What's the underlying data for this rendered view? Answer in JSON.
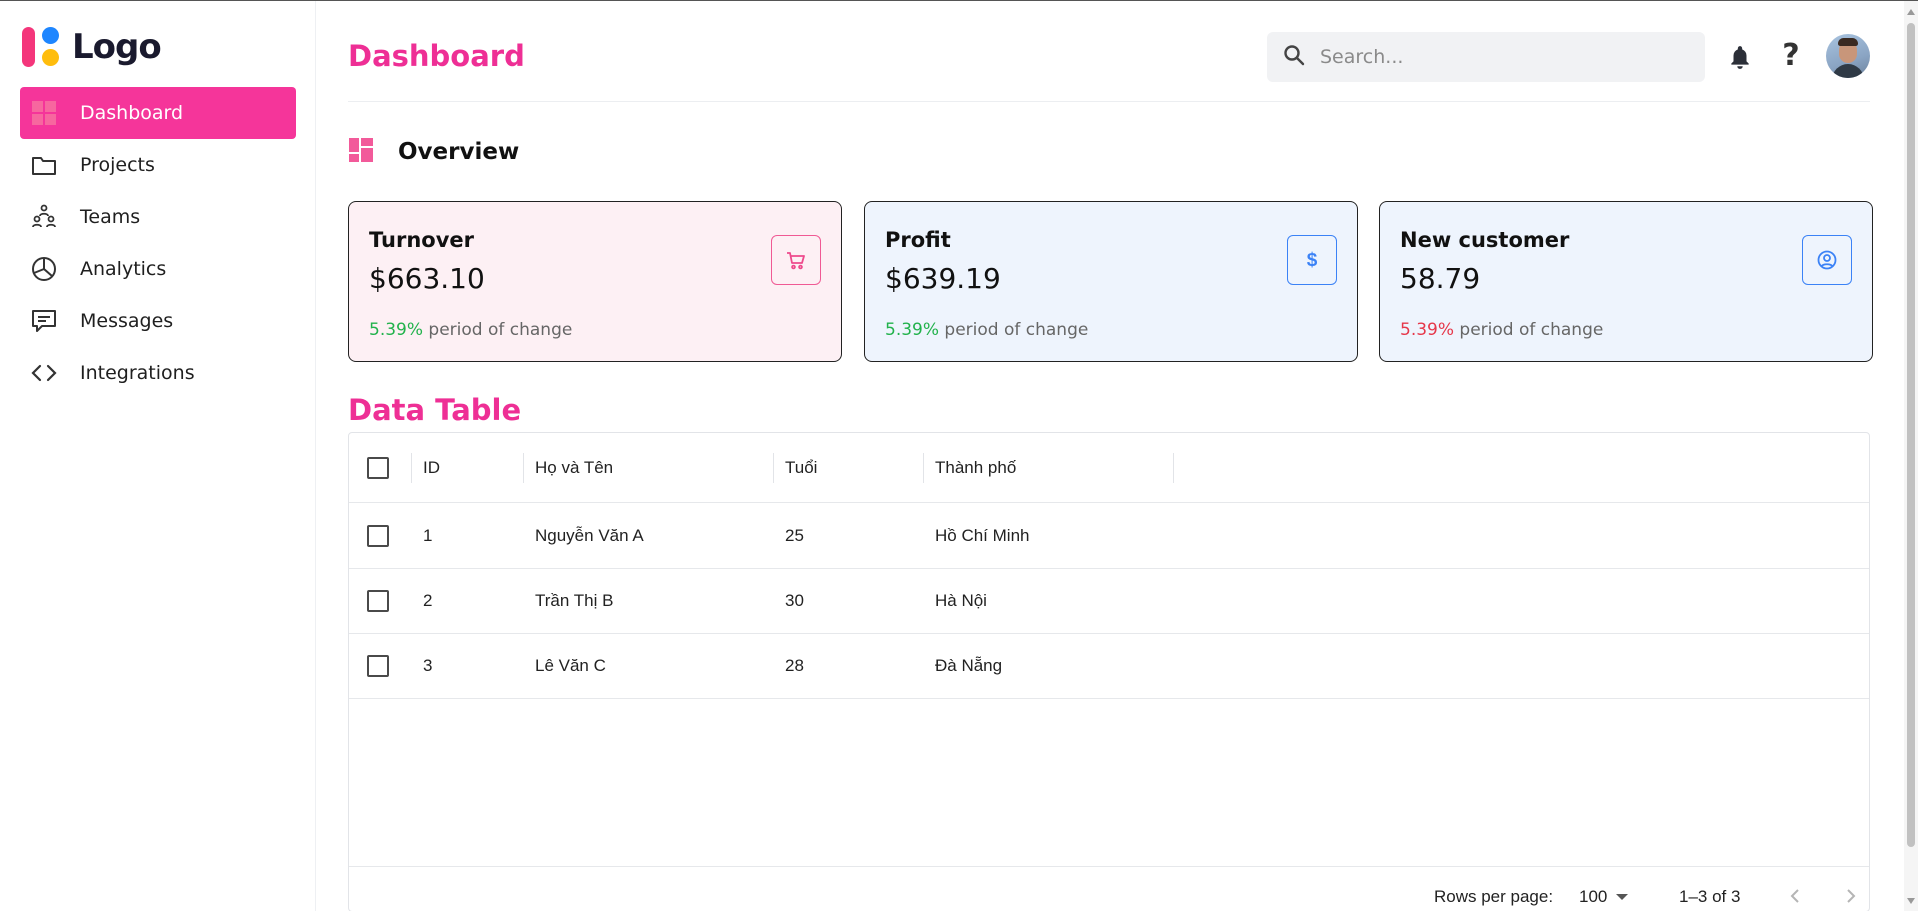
{
  "brand": {
    "name": "Logo"
  },
  "sidebar": {
    "items": [
      {
        "label": "Dashboard",
        "icon": "dashboard-icon",
        "active": true
      },
      {
        "label": "Projects",
        "icon": "folder-icon"
      },
      {
        "label": "Teams",
        "icon": "teams-icon"
      },
      {
        "label": "Analytics",
        "icon": "pie-chart-icon"
      },
      {
        "label": "Messages",
        "icon": "message-icon"
      },
      {
        "label": "Integrations",
        "icon": "code-icon"
      }
    ]
  },
  "header": {
    "title": "Dashboard",
    "search_placeholder": "Search...",
    "help_label": "?"
  },
  "overview": {
    "title": "Overview",
    "cards": [
      {
        "title": "Turnover",
        "value": "$663.10",
        "change": "5.39%",
        "change_text": "period of change",
        "icon": "cart-icon"
      },
      {
        "title": "Profit",
        "value": "$639.19",
        "change": "5.39%",
        "change_text": "period of change",
        "icon": "dollar-icon"
      },
      {
        "title": "New customer",
        "value": "58.79",
        "change": "5.39%",
        "change_text": "period of change",
        "icon": "user-circle-icon"
      }
    ]
  },
  "table": {
    "title": "Data Table",
    "columns": [
      "ID",
      "Họ và Tên",
      "Tuổi",
      "Thành phố"
    ],
    "rows": [
      [
        "1",
        "Nguyễn Văn A",
        "25",
        "Hồ Chí Minh"
      ],
      [
        "2",
        "Trần Thị B",
        "30",
        "Hà Nội"
      ],
      [
        "3",
        "Lê Văn C",
        "28",
        "Đà Nẵng"
      ]
    ],
    "footer": {
      "rows_per_page_label": "Rows per page:",
      "rows_per_page_value": "100",
      "range_text": "1–3 of 3"
    }
  },
  "colors": {
    "accent": "#ee2f95",
    "active_nav": "#f5359a",
    "positive": "#22b24c",
    "negative": "#e6374a",
    "card_pink": "#fdf0f4",
    "card_blue": "#eef4fd"
  }
}
